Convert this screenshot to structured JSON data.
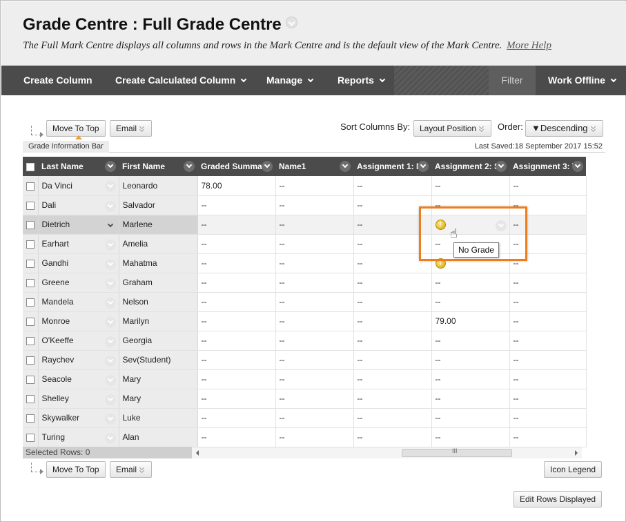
{
  "header": {
    "title": "Grade Centre : Full Grade Centre",
    "subtitle": "The Full Mark Centre displays all columns and rows in the Mark Centre and is the default view of the Mark Centre.",
    "help_link": "More Help"
  },
  "actionbar": {
    "create_column": "Create Column",
    "create_calculated": "Create Calculated Column",
    "manage": "Manage",
    "reports": "Reports",
    "filter": "Filter",
    "work_offline": "Work Offline"
  },
  "toolbar_top": {
    "move_to_top": "Move To Top",
    "email": "Email",
    "sort_label": "Sort Columns By:",
    "sort_value": "Layout Position",
    "order_label": "Order:",
    "order_value": "▼Descending"
  },
  "infobar": {
    "tab": "Grade Information Bar",
    "last_saved": "Last Saved:18 September 2017 15:52"
  },
  "columns": [
    "Last Name",
    "First Name",
    "Graded Summa",
    "Name1",
    "Assignment 1: I",
    "Assignment 2: S",
    "Assignment 3: T"
  ],
  "rows": [
    {
      "last": "Da Vinci",
      "first": "Leonardo",
      "graded": "78.00",
      "name1": "--",
      "a1": "--",
      "a2": "--",
      "a3": "--"
    },
    {
      "last": "Dali",
      "first": "Salvador",
      "graded": "--",
      "name1": "--",
      "a1": "--",
      "a2": "--",
      "a3": "--"
    },
    {
      "last": "Dietrich",
      "first": "Marlene",
      "graded": "--",
      "name1": "--",
      "a1": "--",
      "a2": "",
      "a3": "--"
    },
    {
      "last": "Earhart",
      "first": "Amelia",
      "graded": "--",
      "name1": "--",
      "a1": "--",
      "a2": "--",
      "a3": "--"
    },
    {
      "last": "Gandhi",
      "first": "Mahatma",
      "graded": "--",
      "name1": "--",
      "a1": "--",
      "a2": "",
      "a3": "--"
    },
    {
      "last": "Greene",
      "first": "Graham",
      "graded": "--",
      "name1": "--",
      "a1": "--",
      "a2": "--",
      "a3": "--"
    },
    {
      "last": "Mandela",
      "first": "Nelson",
      "graded": "--",
      "name1": "--",
      "a1": "--",
      "a2": "--",
      "a3": "--"
    },
    {
      "last": "Monroe",
      "first": "Marilyn",
      "graded": "--",
      "name1": "--",
      "a1": "--",
      "a2": "79.00",
      "a3": "--"
    },
    {
      "last": "O'Keeffe",
      "first": "Georgia",
      "graded": "--",
      "name1": "--",
      "a1": "--",
      "a2": "--",
      "a3": "--"
    },
    {
      "last": "Raychev",
      "first": "Sev(Student)",
      "graded": "--",
      "name1": "--",
      "a1": "--",
      "a2": "--",
      "a3": "--"
    },
    {
      "last": "Seacole",
      "first": "Mary",
      "graded": "--",
      "name1": "--",
      "a1": "--",
      "a2": "--",
      "a3": "--"
    },
    {
      "last": "Shelley",
      "first": "Mary",
      "graded": "--",
      "name1": "--",
      "a1": "--",
      "a2": "--",
      "a3": "--"
    },
    {
      "last": "Skywalker",
      "first": "Luke",
      "graded": "--",
      "name1": "--",
      "a1": "--",
      "a2": "--",
      "a3": "--"
    },
    {
      "last": "Turing",
      "first": "Alan",
      "graded": "--",
      "name1": "--",
      "a1": "--",
      "a2": "--",
      "a3": "--"
    }
  ],
  "warning_rows": [
    2,
    4
  ],
  "highlight_row": 2,
  "footer": {
    "selected_rows": "Selected Rows: 0",
    "scroll_grip": "III"
  },
  "toolbar_bottom": {
    "move_to_top": "Move To Top",
    "email": "Email",
    "icon_legend": "Icon Legend",
    "edit_rows": "Edit Rows Displayed"
  },
  "tooltip": "No Grade",
  "icons": {
    "warning": "needs-grading-icon",
    "cursor": "hand-pointer-icon",
    "warning_glyph": "!",
    "cursor_glyph": "☝"
  },
  "colors": {
    "actionbar": "#4b4b4b",
    "callout": "#f07d1b"
  }
}
